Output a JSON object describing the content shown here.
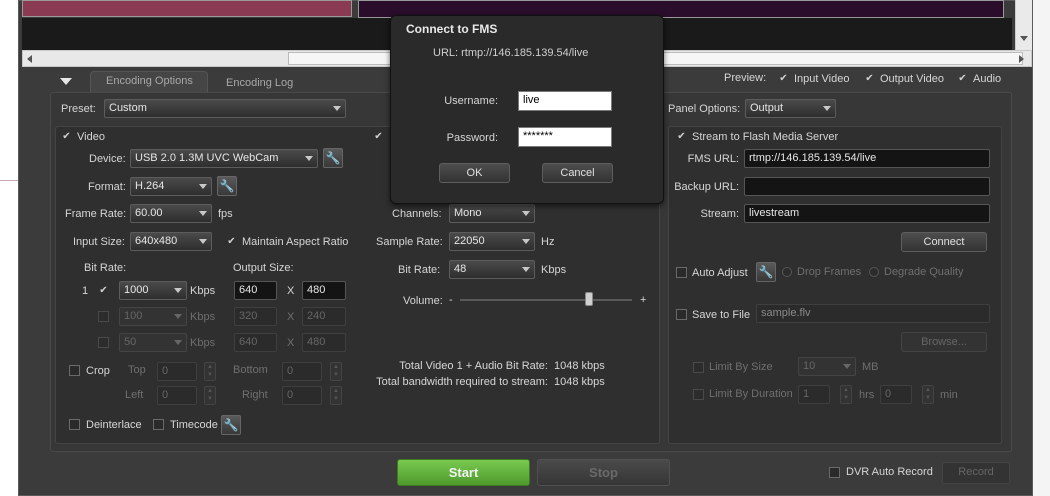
{
  "tabs": {
    "encoding_options": "Encoding Options",
    "encoding_log": "Encoding Log"
  },
  "preview": {
    "label": "Preview:",
    "input_video": "Input Video",
    "output_video": "Output Video",
    "audio": "Audio"
  },
  "preset": {
    "label": "Preset:",
    "value": "Custom"
  },
  "video": {
    "label": "Video",
    "device_label": "Device:",
    "device_value": "USB 2.0 1.3M UVC WebCam",
    "format_label": "Format:",
    "format_value": "H.264",
    "frame_rate_label": "Frame Rate:",
    "frame_rate_value": "60.00",
    "frame_rate_unit": "fps",
    "input_size_label": "Input Size:",
    "input_size_value": "640x480",
    "maintain_aspect": "Maintain Aspect Ratio",
    "bit_rate_label": "Bit Rate:",
    "output_size_label": "Output Size:",
    "rows": [
      {
        "index": "1",
        "bitrate": "1000",
        "unit": "Kbps",
        "w": "640",
        "h": "480"
      },
      {
        "index": "",
        "bitrate": "100",
        "unit": "Kbps",
        "w": "320",
        "h": "240"
      },
      {
        "index": "",
        "bitrate": "50",
        "unit": "Kbps",
        "w": "640",
        "h": "480"
      }
    ],
    "x_sep": "X",
    "crop_label": "Crop",
    "top_label": "Top",
    "bottom_label": "Bottom",
    "left_label": "Left",
    "right_label": "Right",
    "crop_top": "0",
    "crop_bottom": "0",
    "crop_left": "0",
    "crop_right": "0",
    "deinterlace": "Deinterlace",
    "timecode": "Timecode"
  },
  "audio": {
    "channels_label": "Channels:",
    "channels_value": "Mono",
    "sample_rate_label": "Sample Rate:",
    "sample_rate_value": "22050",
    "sample_rate_unit": "Hz",
    "bit_rate_label": "Bit Rate:",
    "bit_rate_value": "48",
    "bit_rate_unit": "Kbps",
    "volume_label": "Volume:",
    "volume_minus": "-",
    "volume_plus": "+",
    "volume_level": 0.75
  },
  "totals": {
    "total_label": "Total Video 1 + Audio Bit Rate:",
    "total_value": "1048 kbps",
    "bandwidth_label": "Total bandwidth required to stream:",
    "bandwidth_value": "1048 kbps"
  },
  "panel": {
    "options_label": "Panel Options:",
    "options_value": "Output",
    "stream_fms": "Stream to Flash Media Server",
    "fms_url_label": "FMS URL:",
    "fms_url_value": "rtmp://146.185.139.54/live",
    "backup_url_label": "Backup URL:",
    "backup_url_value": "",
    "stream_label": "Stream:",
    "stream_value": "livestream",
    "connect": "Connect",
    "auto_adjust": "Auto Adjust",
    "drop_frames": "Drop Frames",
    "degrade_quality": "Degrade Quality",
    "save_to_file": "Save to File",
    "file_value": "sample.flv",
    "browse": "Browse...",
    "limit_size": "Limit By Size",
    "limit_size_value": "10",
    "limit_size_unit": "MB",
    "limit_duration": "Limit By Duration",
    "hrs_value": "1",
    "hrs_unit": "hrs",
    "min_value": "0",
    "min_unit": "min"
  },
  "bottom": {
    "start": "Start",
    "stop": "Stop",
    "dvr_auto_record": "DVR Auto Record",
    "record": "Record"
  },
  "dialog": {
    "title": "Connect to FMS",
    "url": "URL: rtmp://146.185.139.54/live",
    "username_label": "Username:",
    "username_value": "live",
    "password_label": "Password:",
    "password_value": "*******",
    "ok": "OK",
    "cancel": "Cancel"
  },
  "colors": {
    "app_bg": "#3a3a3a",
    "panel_bg": "#333333",
    "start_green": "#5fae3a",
    "dialog_bg": "#3c3c3c"
  }
}
